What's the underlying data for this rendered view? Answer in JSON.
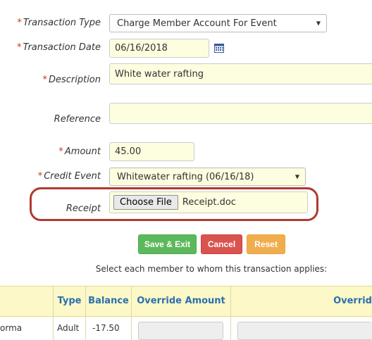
{
  "form": {
    "required_mark": "*",
    "transaction_type": {
      "label": "Transaction Type",
      "value": "Charge Member Account For Event"
    },
    "transaction_date": {
      "label": "Transaction Date",
      "value": "06/16/2018"
    },
    "description": {
      "label": "Description",
      "value": "White water rafting"
    },
    "reference": {
      "label": "Reference",
      "value": ""
    },
    "amount": {
      "label": "Amount",
      "value": "45.00"
    },
    "credit_event": {
      "label": "Credit Event",
      "value": "Whitewater rafting (06/16/18)"
    },
    "receipt": {
      "label": "Receipt",
      "button": "Choose File",
      "filename": "Receipt.doc"
    }
  },
  "buttons": {
    "save": "Save & Exit",
    "cancel": "Cancel",
    "reset": "Reset"
  },
  "instructions": "Select each member to whom this transaction applies:",
  "table": {
    "headers": {
      "type": "Type",
      "balance": "Balance",
      "override_amount": "Override Amount",
      "override2": "Overrid"
    },
    "rows": [
      {
        "name": "orma",
        "type": "Adult",
        "balance": "-17.50"
      }
    ]
  },
  "colors": {
    "highlight": "#b03a2e",
    "save": "#5cb85c",
    "cancel": "#d9534f",
    "reset": "#f0ad4e",
    "header_text": "#2a6fb0"
  },
  "icons": {
    "date_picker": "calendar-icon",
    "dropdown": "chevron-down-icon"
  }
}
